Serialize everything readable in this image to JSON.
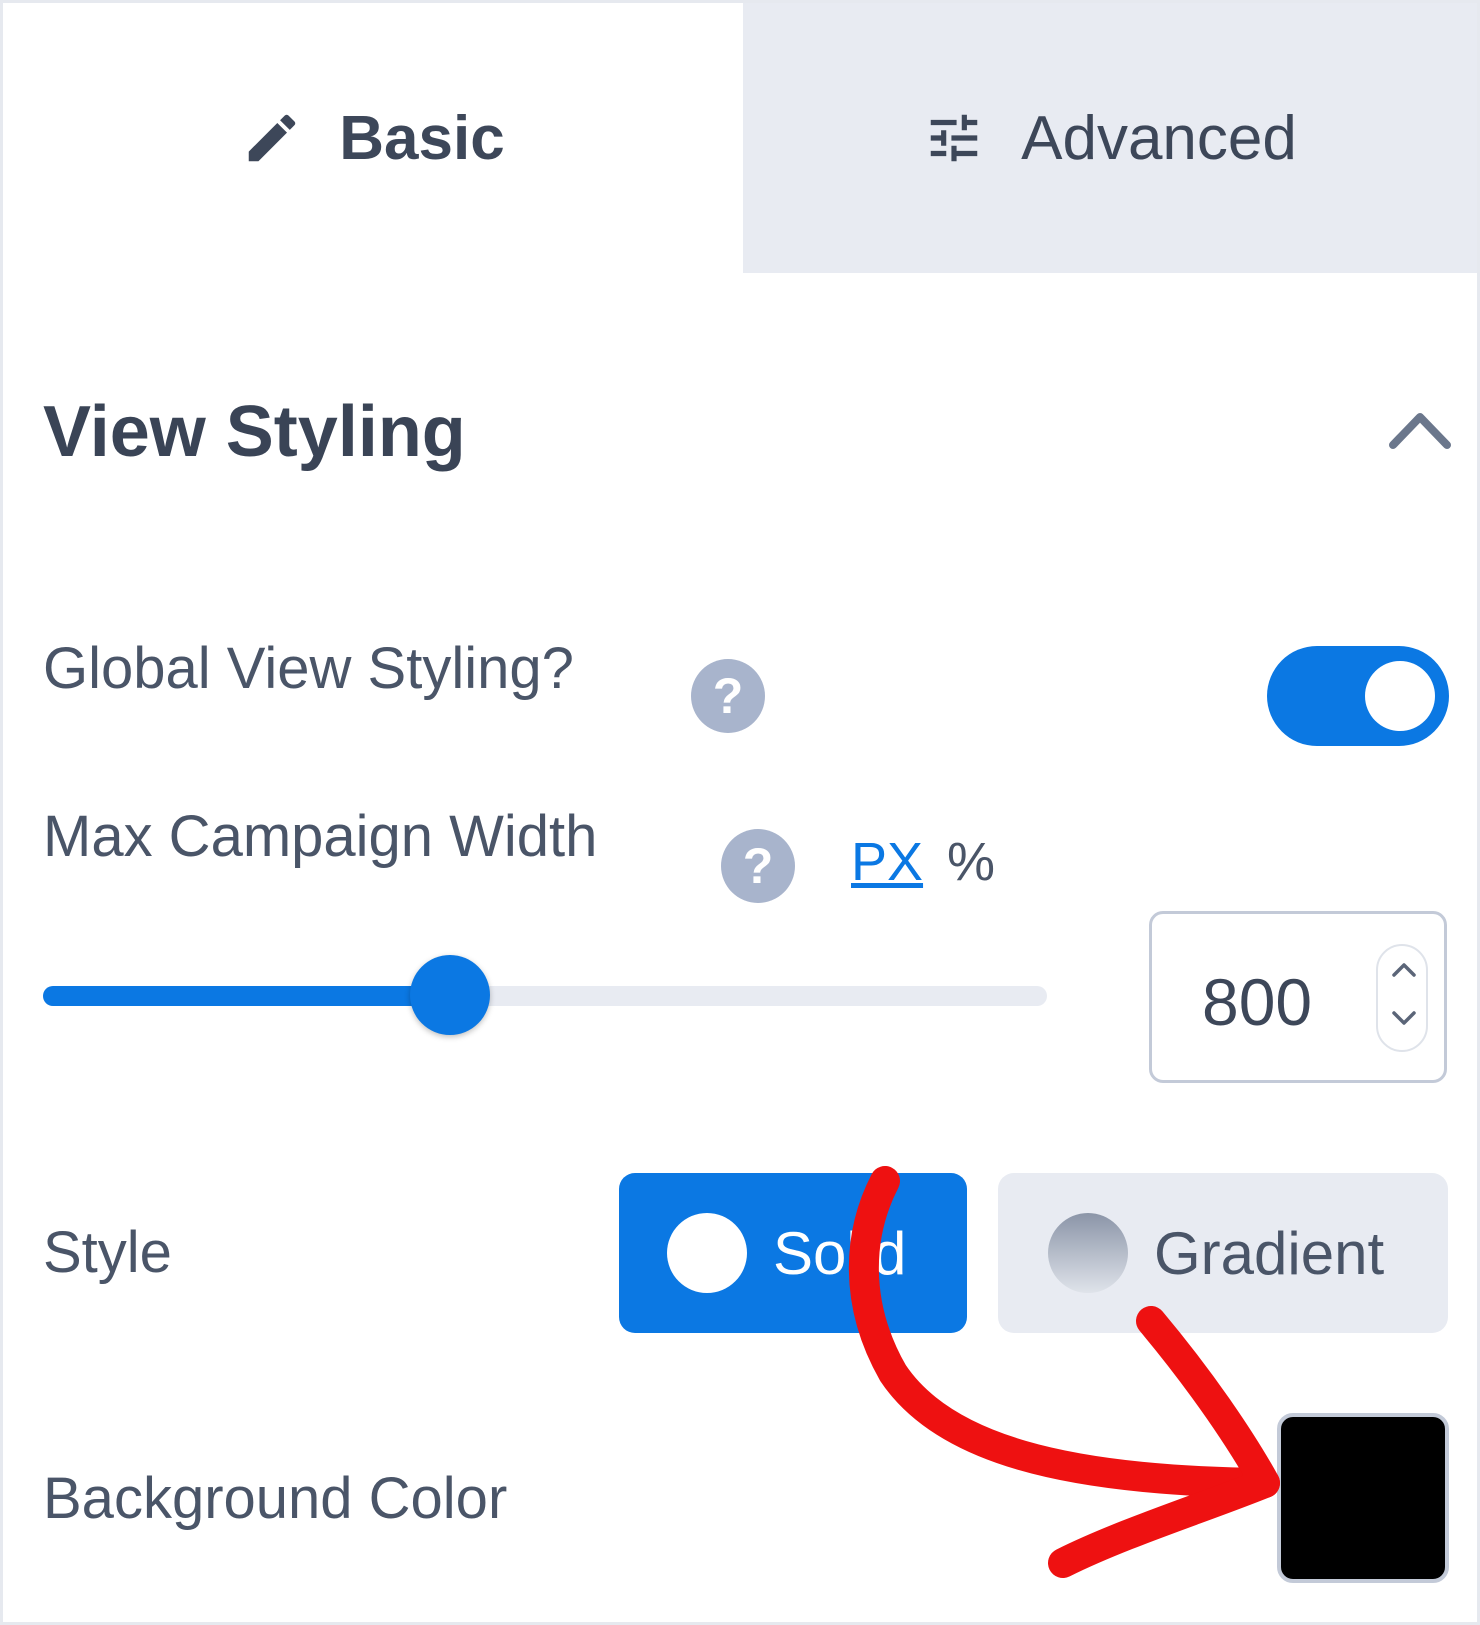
{
  "tabs": {
    "basic": {
      "label": "Basic",
      "icon": "pencil-icon"
    },
    "advanced": {
      "label": "Advanced",
      "icon": "sliders-icon"
    }
  },
  "section": {
    "title": "View Styling",
    "expanded": true
  },
  "global_view_styling": {
    "label": "Global View Styling?",
    "help": "?",
    "enabled": true
  },
  "max_campaign_width": {
    "label": "Max Campaign Width",
    "help": "?",
    "units": [
      "PX",
      "%"
    ],
    "selected_unit": "PX",
    "value": "800",
    "slider_fraction": 0.405
  },
  "style": {
    "label": "Style",
    "options": [
      {
        "label": "Solid",
        "selected": true
      },
      {
        "label": "Gradient",
        "selected": false
      }
    ]
  },
  "background_color": {
    "label": "Background Color",
    "value": "#000000"
  },
  "colors": {
    "accent": "#0b78e3",
    "annotation": "#ee1111"
  }
}
